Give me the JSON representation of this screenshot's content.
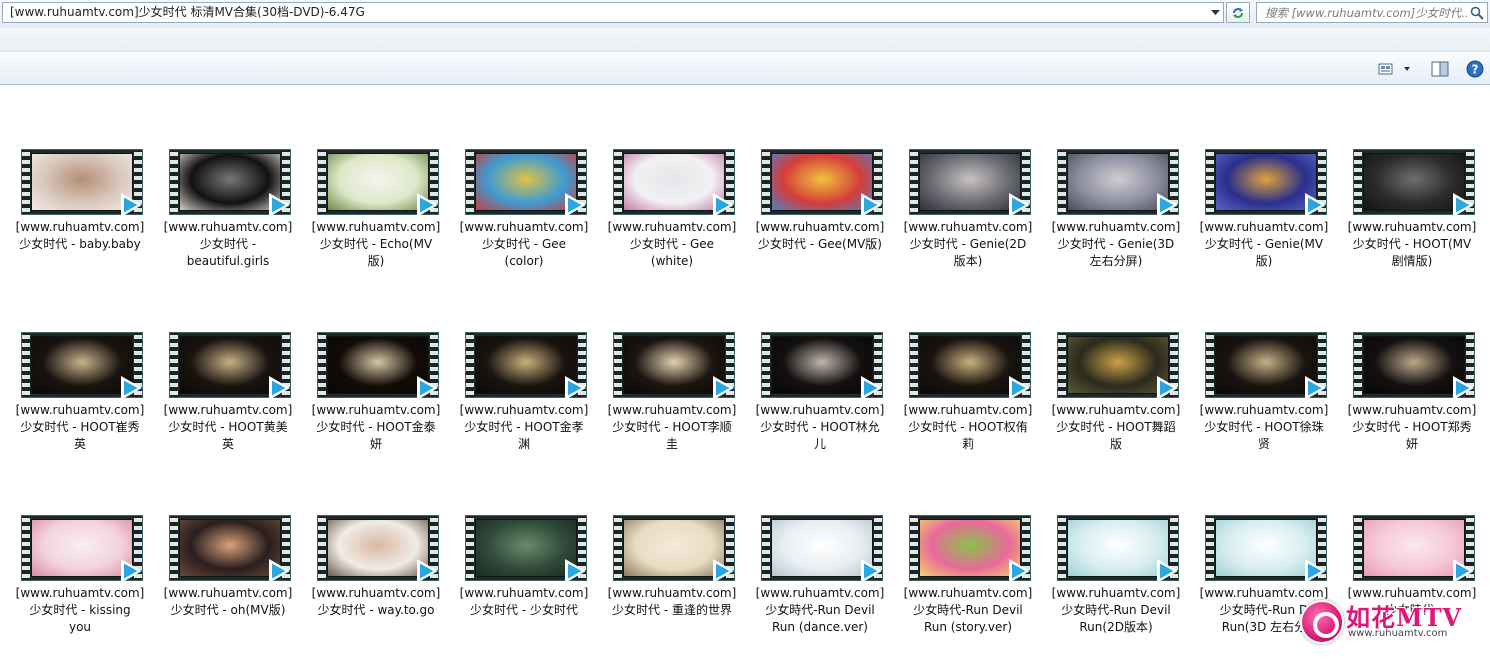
{
  "address_bar": {
    "path": "[www.ruhuamtv.com]少女时代 标清MV合集(30档-DVD)-6.47G"
  },
  "search": {
    "placeholder": "搜索 [www.ruhuamtv.com]少女时代..."
  },
  "colors": {
    "accent": "#2aa6e0",
    "film_border": "#3f6262",
    "watermark_pink": "#e0157a"
  },
  "icons": {
    "address_dropdown": "chevron-down-icon",
    "refresh": "refresh-icon",
    "search": "search-icon",
    "view": "view-options-icon",
    "preview_pane": "preview-pane-icon",
    "help": "help-icon",
    "play": "play-icon"
  },
  "files": [
    {
      "line1": "[www.ruhuamtv.com]",
      "line2": "少女时代 - baby.baby",
      "line3": "",
      "tone": [
        "#d9c8bd",
        "#b58e76",
        "#f3ece6"
      ]
    },
    {
      "line1": "[www.ruhuamtv.com]",
      "line2": "少女时代 -",
      "line3": "beautiful.girls",
      "tone": [
        "#111111",
        "#777777",
        "#d7cfc7"
      ]
    },
    {
      "line1": "[www.ruhuamtv.com]",
      "line2": "少女时代 - Echo(MV",
      "line3": "版)",
      "tone": [
        "#dfe8c9",
        "#f4f4f0",
        "#6b8a4a"
      ]
    },
    {
      "line1": "[www.ruhuamtv.com]",
      "line2": "少女时代 - Gee",
      "line3": "(color)",
      "tone": [
        "#3f9bd1",
        "#e0c242",
        "#c63d3d"
      ]
    },
    {
      "line1": "[www.ruhuamtv.com]",
      "line2": "少女时代 - Gee",
      "line3": "(white)",
      "tone": [
        "#f1f1f3",
        "#e6e6ea",
        "#c77aa4"
      ]
    },
    {
      "line1": "[www.ruhuamtv.com]",
      "line2": "少女时代 - Gee(MV版)",
      "line3": "",
      "tone": [
        "#d43e3a",
        "#f2c23c",
        "#4f7fc2"
      ]
    },
    {
      "line1": "[www.ruhuamtv.com]",
      "line2": "少女时代 - Genie(2D",
      "line3": "版本)",
      "tone": [
        "#6b6b73",
        "#c9c3c0",
        "#2e2e36"
      ]
    },
    {
      "line1": "[www.ruhuamtv.com]",
      "line2": "少女时代 - Genie(3D",
      "line3": "左右分屏)",
      "tone": [
        "#8c8fa1",
        "#d2ccd0",
        "#4b4b58"
      ]
    },
    {
      "line1": "[www.ruhuamtv.com]",
      "line2": "少女时代 - Genie(MV",
      "line3": "版)",
      "tone": [
        "#2a2f8c",
        "#e0a33a",
        "#5c63c9"
      ]
    },
    {
      "line1": "[www.ruhuamtv.com]",
      "line2": "少女时代 - HOOT(MV",
      "line3": "剧情版)",
      "tone": [
        "#2b2b2b",
        "#6f6f6f",
        "#141414"
      ]
    },
    {
      "line1": "[www.ruhuamtv.com]",
      "line2": "少女时代 - HOOT崔秀",
      "line3": "英",
      "tone": [
        "#1a1410",
        "#c8b48a",
        "#0b0806"
      ]
    },
    {
      "line1": "[www.ruhuamtv.com]",
      "line2": "少女时代 - HOOT黄美",
      "line3": "英",
      "tone": [
        "#1a1410",
        "#c6b086",
        "#0b0806"
      ]
    },
    {
      "line1": "[www.ruhuamtv.com]",
      "line2": "少女时代 - HOOT金泰",
      "line3": "妍",
      "tone": [
        "#120c08",
        "#d6c6a2",
        "#0a0604"
      ]
    },
    {
      "line1": "[www.ruhuamtv.com]",
      "line2": "少女时代 - HOOT金孝",
      "line3": "渊",
      "tone": [
        "#1a1410",
        "#c9b07c",
        "#0b0806"
      ]
    },
    {
      "line1": "[www.ruhuamtv.com]",
      "line2": "少女时代 - HOOT李顺",
      "line3": "圭",
      "tone": [
        "#1c1410",
        "#e3d1b0",
        "#0b0806"
      ]
    },
    {
      "line1": "[www.ruhuamtv.com]",
      "line2": "少女时代 - HOOT林允",
      "line3": "儿",
      "tone": [
        "#141010",
        "#bfb7ad",
        "#070505"
      ]
    },
    {
      "line1": "[www.ruhuamtv.com]",
      "line2": "少女时代 - HOOT权侑",
      "line3": "莉",
      "tone": [
        "#1a1410",
        "#c9b07c",
        "#0b0806"
      ]
    },
    {
      "line1": "[www.ruhuamtv.com]",
      "line2": "少女时代 - HOOT舞蹈",
      "line3": "版",
      "tone": [
        "#2b2a1c",
        "#c9a24a",
        "#5a5a3a"
      ]
    },
    {
      "line1": "[www.ruhuamtv.com]",
      "line2": "少女时代 - HOOT徐珠",
      "line3": "贤",
      "tone": [
        "#1a1410",
        "#c6b086",
        "#0b0806"
      ]
    },
    {
      "line1": "[www.ruhuamtv.com]",
      "line2": "少女时代 - HOOT郑秀",
      "line3": "妍",
      "tone": [
        "#141010",
        "#bba98a",
        "#070505"
      ]
    },
    {
      "line1": "[www.ruhuamtv.com]",
      "line2": "少女时代 - kissing",
      "line3": "you",
      "tone": [
        "#f3d3dc",
        "#f8eef2",
        "#d98aa3"
      ]
    },
    {
      "line1": "[www.ruhuamtv.com]",
      "line2": "少女时代 - oh(MV版)",
      "line3": "",
      "tone": [
        "#2a1e1e",
        "#d8a27a",
        "#6a4a3a"
      ]
    },
    {
      "line1": "[www.ruhuamtv.com]",
      "line2": "少女时代 - way.to.go",
      "line3": "",
      "tone": [
        "#f1ece6",
        "#d9b8a0",
        "#6b5a4a"
      ]
    },
    {
      "line1": "[www.ruhuamtv.com]",
      "line2": "少女时代 - 少女时代",
      "line3": "",
      "tone": [
        "#2f4a3a",
        "#6c8a6a",
        "#1a2a20"
      ]
    },
    {
      "line1": "[www.ruhuamtv.com]",
      "line2": "少女时代 - 重逢的世界",
      "line3": "",
      "tone": [
        "#e9dcc2",
        "#f3eadb",
        "#8a7a62"
      ]
    },
    {
      "line1": "[www.ruhuamtv.com]",
      "line2": "少女時代-Run Devil",
      "line3": "Run (dance.ver)",
      "tone": [
        "#e8eef2",
        "#ffffff",
        "#b9c6d0"
      ]
    },
    {
      "line1": "[www.ruhuamtv.com]",
      "line2": "少女時代-Run Devil",
      "line3": "Run (story.ver)",
      "tone": [
        "#e86a9a",
        "#8ac24a",
        "#f2d26a"
      ]
    },
    {
      "line1": "[www.ruhuamtv.com]",
      "line2": "少女時代-Run Devil",
      "line3": "Run(2D版本)",
      "tone": [
        "#d8eef0",
        "#ffffff",
        "#9fd0d6"
      ]
    },
    {
      "line1": "[www.ruhuamtv.com]",
      "line2": "少女時代-Run D",
      "line3": "Run(3D 左右分",
      "tone": [
        "#d8eef0",
        "#ffffff",
        "#9fd0d6"
      ]
    },
    {
      "line1": "[www.ruhuamtv.com]",
      "line2": "少女時代-",
      "line3": "",
      "tone": [
        "#f5c8d6",
        "#fbe8ee",
        "#e79ab4"
      ]
    }
  ],
  "watermark": {
    "title": "如花MTV",
    "url": "www.ruhuamtv.com"
  }
}
